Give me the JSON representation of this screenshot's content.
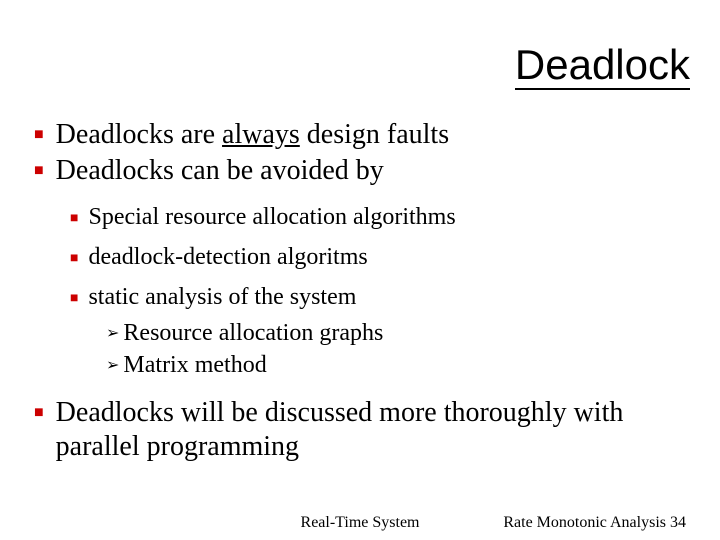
{
  "title": "Deadlock",
  "bullets": {
    "b1_pre": "Deadlocks are ",
    "b1_u": "always",
    "b1_post": " design faults",
    "b2": "Deadlocks can be avoided by",
    "b2a": "Special resource allocation algorithms",
    "b2b": "deadlock-detection algoritms",
    "b2c": "static analysis of the system",
    "b2c1": "Resource allocation graphs",
    "b2c2": "Matrix method",
    "b3": "Deadlocks will be discussed more thoroughly with parallel programming"
  },
  "footer": {
    "center": "Real-Time System",
    "right": "Rate Monotonic Analysis 34"
  }
}
